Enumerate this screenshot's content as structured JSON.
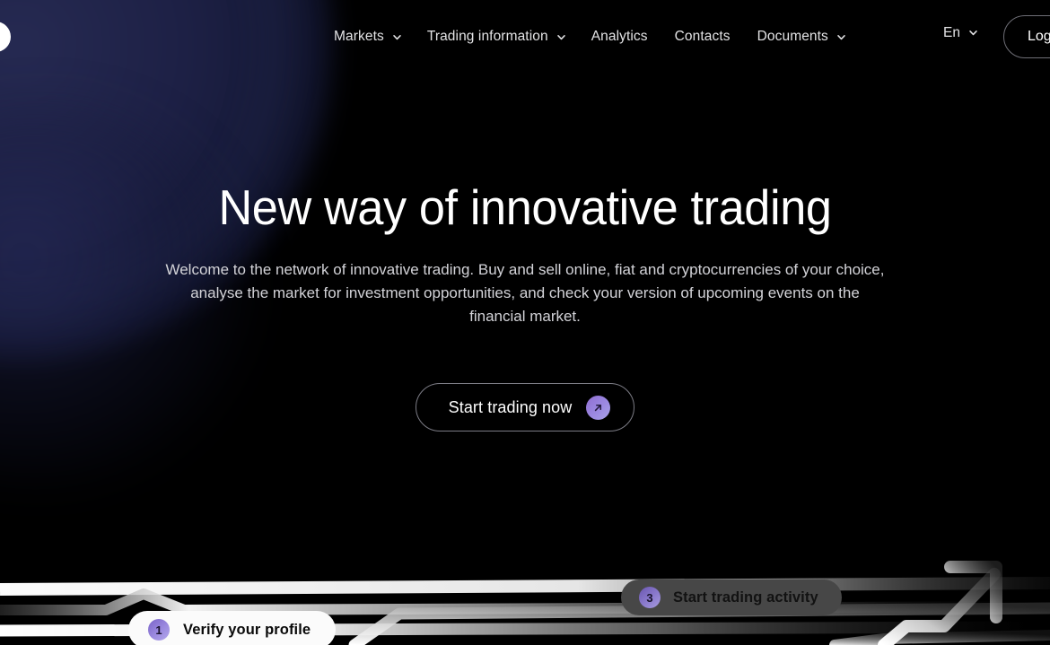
{
  "header": {
    "logo_icon": "circle-logo-icon",
    "nav": [
      {
        "label": "Markets",
        "has_dropdown": true,
        "icon": "chevron-down-icon"
      },
      {
        "label": "Trading information",
        "has_dropdown": true,
        "icon": "chevron-down-icon"
      },
      {
        "label": "Analytics",
        "has_dropdown": false
      },
      {
        "label": "Contacts",
        "has_dropdown": false
      },
      {
        "label": "Documents",
        "has_dropdown": true,
        "icon": "chevron-down-icon"
      }
    ],
    "language": {
      "label": "En",
      "icon": "chevron-down-icon"
    },
    "login_label": "Log in"
  },
  "hero": {
    "title": "New way of innovative trading",
    "subtitle": "Welcome to the network of innovative trading. Buy and sell online, fiat and cryptocurrencies of your choice, analyse the market for investment opportunities, and check your version of upcoming events on the financial market.",
    "cta": {
      "label": "Start trading now",
      "icon": "arrow-up-right-icon"
    }
  },
  "steps": [
    {
      "number": "1",
      "label": "Verify your profile"
    },
    {
      "number": "3",
      "label": "Start trading activity"
    }
  ],
  "decor": {
    "arrow_icon": "trend-arrow-up-icon",
    "line_tracks": "circuit-path-lines"
  },
  "colors": {
    "background": "#000000",
    "glow": "#262a52",
    "accent_purple": "#9a86e0",
    "accent_purple_dark": "#7a63c8",
    "text_primary": "#ffffff",
    "text_secondary": "#d3d3d8",
    "pill_light_bg": "#fbfbfb",
    "pill_dark_bg": "#474747"
  }
}
